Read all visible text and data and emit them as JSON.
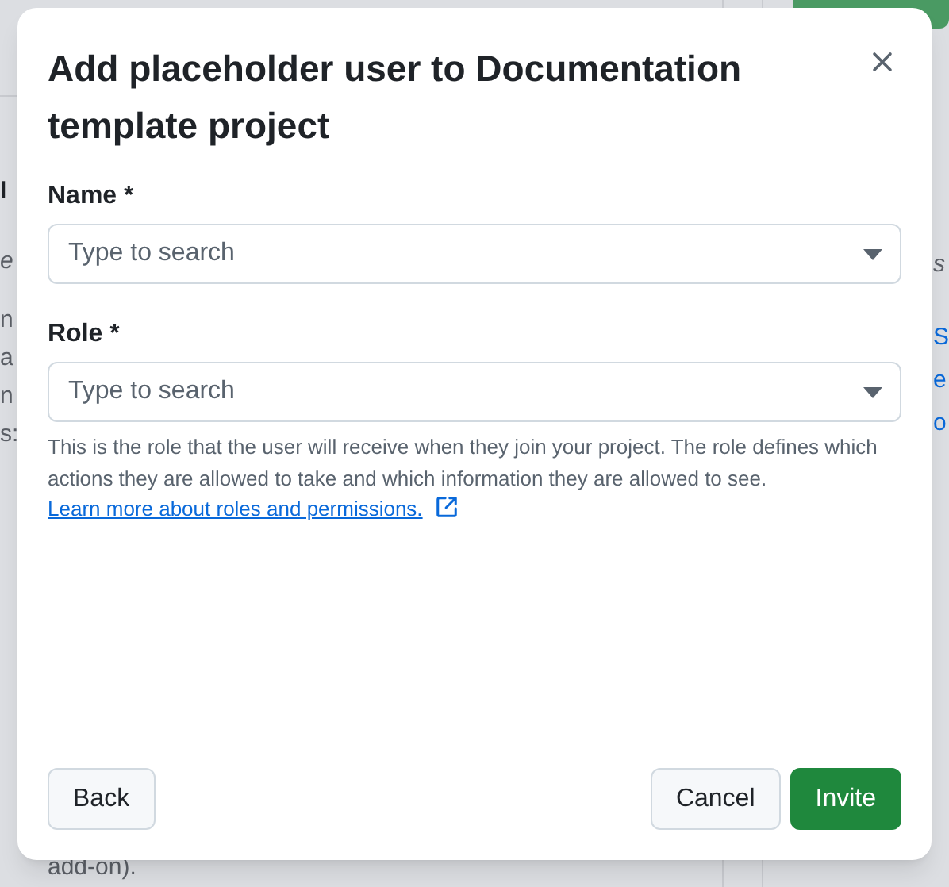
{
  "background": {
    "left_fragments": [
      {
        "text": "l",
        "kind": "heading"
      },
      {
        "text": "e",
        "kind": "italic"
      },
      {
        "text": "n",
        "kind": "plain"
      },
      {
        "text": "a",
        "kind": "plain"
      },
      {
        "text": "n",
        "kind": "plain"
      },
      {
        "text": "s:",
        "kind": "plain"
      }
    ],
    "right_fragments": [
      {
        "text": "s",
        "kind": "italic"
      },
      {
        "text": "S",
        "kind": "link"
      },
      {
        "text": "e",
        "kind": "link"
      },
      {
        "text": "o",
        "kind": "link"
      }
    ],
    "bottom_fragment": "add-on)."
  },
  "dialog": {
    "title": "Add placeholder user to Documentation template project",
    "fields": [
      {
        "label": "Name *",
        "placeholder": "Type to search"
      },
      {
        "label": "Role *",
        "placeholder": "Type to search"
      }
    ],
    "help_text": "This is the role that the user will receive when they join your project. The role defines which actions they are allowed to take and which information they are allowed to see.",
    "help_link": "Learn more about roles and permissions.",
    "buttons": [
      {
        "label": "Back",
        "kind": "secondary"
      },
      {
        "label": "Cancel",
        "kind": "secondary"
      },
      {
        "label": "Invite",
        "kind": "primary"
      }
    ]
  }
}
